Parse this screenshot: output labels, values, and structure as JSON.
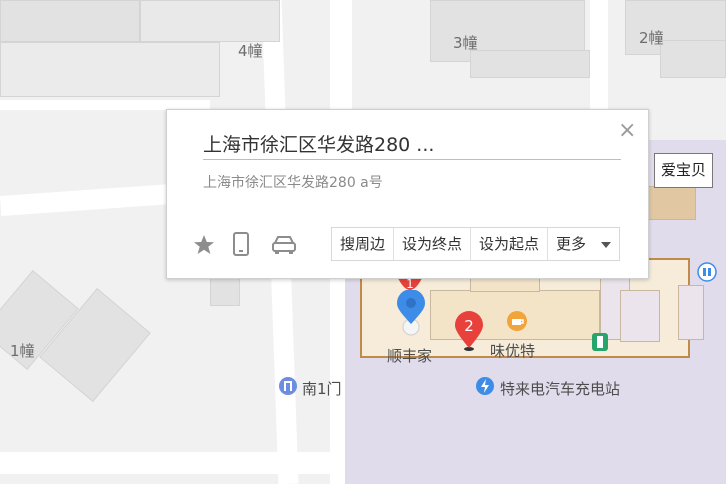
{
  "popup": {
    "title": "上海市徐汇区华发路280 ...",
    "address": "上海市徐汇区华发路280 a号",
    "close_symbol": "×",
    "icons": [
      "star-icon",
      "phone-icon",
      "car-icon"
    ],
    "actions": [
      "搜周边",
      "设为终点",
      "设为起点",
      "更多"
    ]
  },
  "side_button": {
    "label": "爱宝贝"
  },
  "map": {
    "building_labels": [
      "4幢",
      "3幢",
      "2幢",
      "1幢"
    ],
    "pois": {
      "shunfengjia": "顺丰家",
      "weiyoute": "味优特",
      "south_gate": "南1门",
      "charging": "特来电汽车充电站"
    },
    "markers": [
      "1",
      "2"
    ]
  },
  "colors": {
    "marker_red": "#e8413b",
    "marker_blue": "#3d8ce8",
    "campus": "#e1dcec",
    "mall_border": "#c08a4a"
  }
}
